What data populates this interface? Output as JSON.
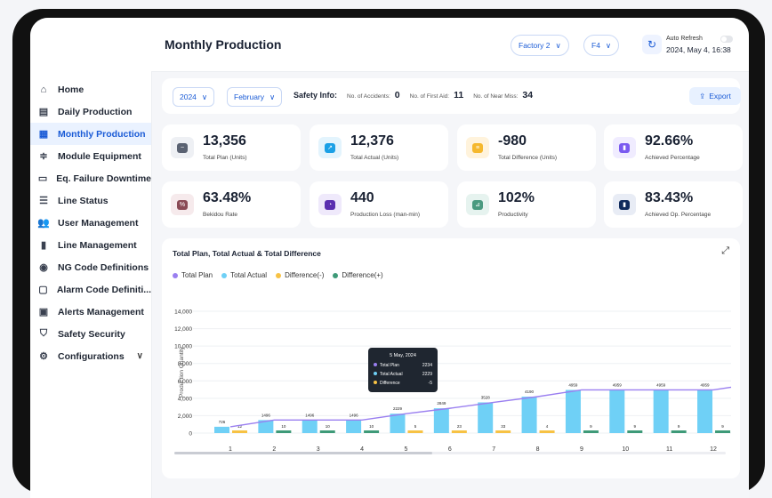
{
  "sidebar": {
    "items": [
      {
        "label": "Home",
        "icon": "home-icon",
        "glyph": "⌂"
      },
      {
        "label": "Daily Production",
        "icon": "factory-icon",
        "glyph": "▤"
      },
      {
        "label": "Monthly Production",
        "icon": "calendar-icon",
        "glyph": "▦"
      },
      {
        "label": "Module Equipment",
        "icon": "sliders-icon",
        "glyph": "≑"
      },
      {
        "label": "Eq. Failure Downtime",
        "icon": "monitor-icon",
        "glyph": "▭"
      },
      {
        "label": "Line Status",
        "icon": "list-icon",
        "glyph": "☰"
      },
      {
        "label": "User Management",
        "icon": "users-icon",
        "glyph": "👥"
      },
      {
        "label": "Line Management",
        "icon": "bars-icon",
        "glyph": "▮"
      },
      {
        "label": "NG Code Definitions",
        "icon": "target-icon",
        "glyph": "◉"
      },
      {
        "label": "Alarm Code Definiti...",
        "icon": "chat-icon",
        "glyph": "▢"
      },
      {
        "label": "Alerts Management",
        "icon": "alert-icon",
        "glyph": "▣"
      },
      {
        "label": "Safety Security",
        "icon": "shield-icon",
        "glyph": "⛉"
      },
      {
        "label": "Configurations",
        "icon": "gear-icon",
        "glyph": "⚙"
      }
    ],
    "active_index": 2,
    "expand_glyph": "∨"
  },
  "header": {
    "title": "Monthly Production",
    "factory": "Factory 2",
    "floor": "F4",
    "auto_refresh_label": "Auto Refresh",
    "datetime": "2024, May 4, 16:38"
  },
  "filters": {
    "year": "2024",
    "month": "February",
    "safety_label": "Safety Info:",
    "accidents_label": "No. of Accidents:",
    "accidents_value": "0",
    "first_aid_label": "No. of First Aid:",
    "first_aid_value": "11",
    "near_miss_label": "No. of Near Miss:",
    "near_miss_value": "34",
    "export_label": "Export"
  },
  "kpis": [
    {
      "value": "13,356",
      "label": "Total Plan (Units)",
      "bg": "#eef0f4",
      "fg": "#5a6272",
      "glyph": "~"
    },
    {
      "value": "12,376",
      "label": "Total Actual (Units)",
      "bg": "#e3f4fd",
      "fg": "#1aa0e6",
      "glyph": "↗"
    },
    {
      "value": "-980",
      "label": "Total Difference (Units)",
      "bg": "#fff3dc",
      "fg": "#f5b82e",
      "glyph": "≡"
    },
    {
      "value": "92.66%",
      "label": "Achieved Percentage",
      "bg": "#f0ecff",
      "fg": "#7a5af0",
      "glyph": "▮"
    },
    {
      "value": "63.48%",
      "label": "Bekidou Rate",
      "bg": "#f6eaec",
      "fg": "#8a4a55",
      "glyph": "%"
    },
    {
      "value": "440",
      "label": "Production Loss (man-min)",
      "bg": "#efe9fb",
      "fg": "#5b2fb0",
      "glyph": "◔"
    },
    {
      "value": "102%",
      "label": "Productivity",
      "bg": "#e6f3ef",
      "fg": "#4a9a80",
      "glyph": "⊿"
    },
    {
      "value": "83.43%",
      "label": "Achieved Op. Percentage",
      "bg": "#e8ecf5",
      "fg": "#0f2a5c",
      "glyph": "▮"
    }
  ],
  "chart": {
    "title": "Total Plan, Total Actual & Total Difference",
    "colors": {
      "plan": "#9a7ff0",
      "actual": "#6fd0f6",
      "diff_neg": "#f7c244",
      "diff_pos": "#3e9a78"
    },
    "tooltip": {
      "title": "5 May, 2024",
      "rows": [
        {
          "label": "Total Plan",
          "value": "2234",
          "color": "#9a7ff0"
        },
        {
          "label": "Total Actual",
          "value": "2229",
          "color": "#6fd0f6"
        },
        {
          "label": "Difference",
          "value": "-5",
          "color": "#f7c244"
        }
      ]
    }
  },
  "chart_data": {
    "type": "bar",
    "title": "Total Plan, Total Actual & Total Difference",
    "ylabel": "Production Quantity",
    "xlabel": "",
    "ylim": [
      0,
      14000
    ],
    "yticks": [
      "0",
      "2,000",
      "4,000",
      "6,000",
      "8,000",
      "10,000",
      "12,000",
      "14,000"
    ],
    "legend_position": "top-left",
    "grid": true,
    "categories": [
      "1",
      "2",
      "3",
      "4",
      "5",
      "6",
      "7",
      "8",
      "9",
      "10",
      "11",
      "12"
    ],
    "series": [
      {
        "name": "Total Plan",
        "kind": "line",
        "values": [
          726,
          1496,
          1496,
          1496,
          2234,
          2849,
          3528,
          4190,
          4959,
          4959,
          4959,
          4959
        ]
      },
      {
        "name": "Total Actual",
        "kind": "bar",
        "values": [
          726,
          1496,
          1496,
          1496,
          2229,
          2849,
          3528,
          4190,
          4959,
          4959,
          4959,
          4959
        ]
      },
      {
        "name": "Difference(-)",
        "kind": "bar",
        "values": [
          12,
          null,
          null,
          null,
          5,
          23,
          33,
          4,
          null,
          null,
          null,
          null
        ]
      },
      {
        "name": "Difference(+)",
        "kind": "bar",
        "values": [
          null,
          10,
          10,
          10,
          null,
          null,
          null,
          null,
          9,
          9,
          9,
          9
        ]
      }
    ]
  }
}
